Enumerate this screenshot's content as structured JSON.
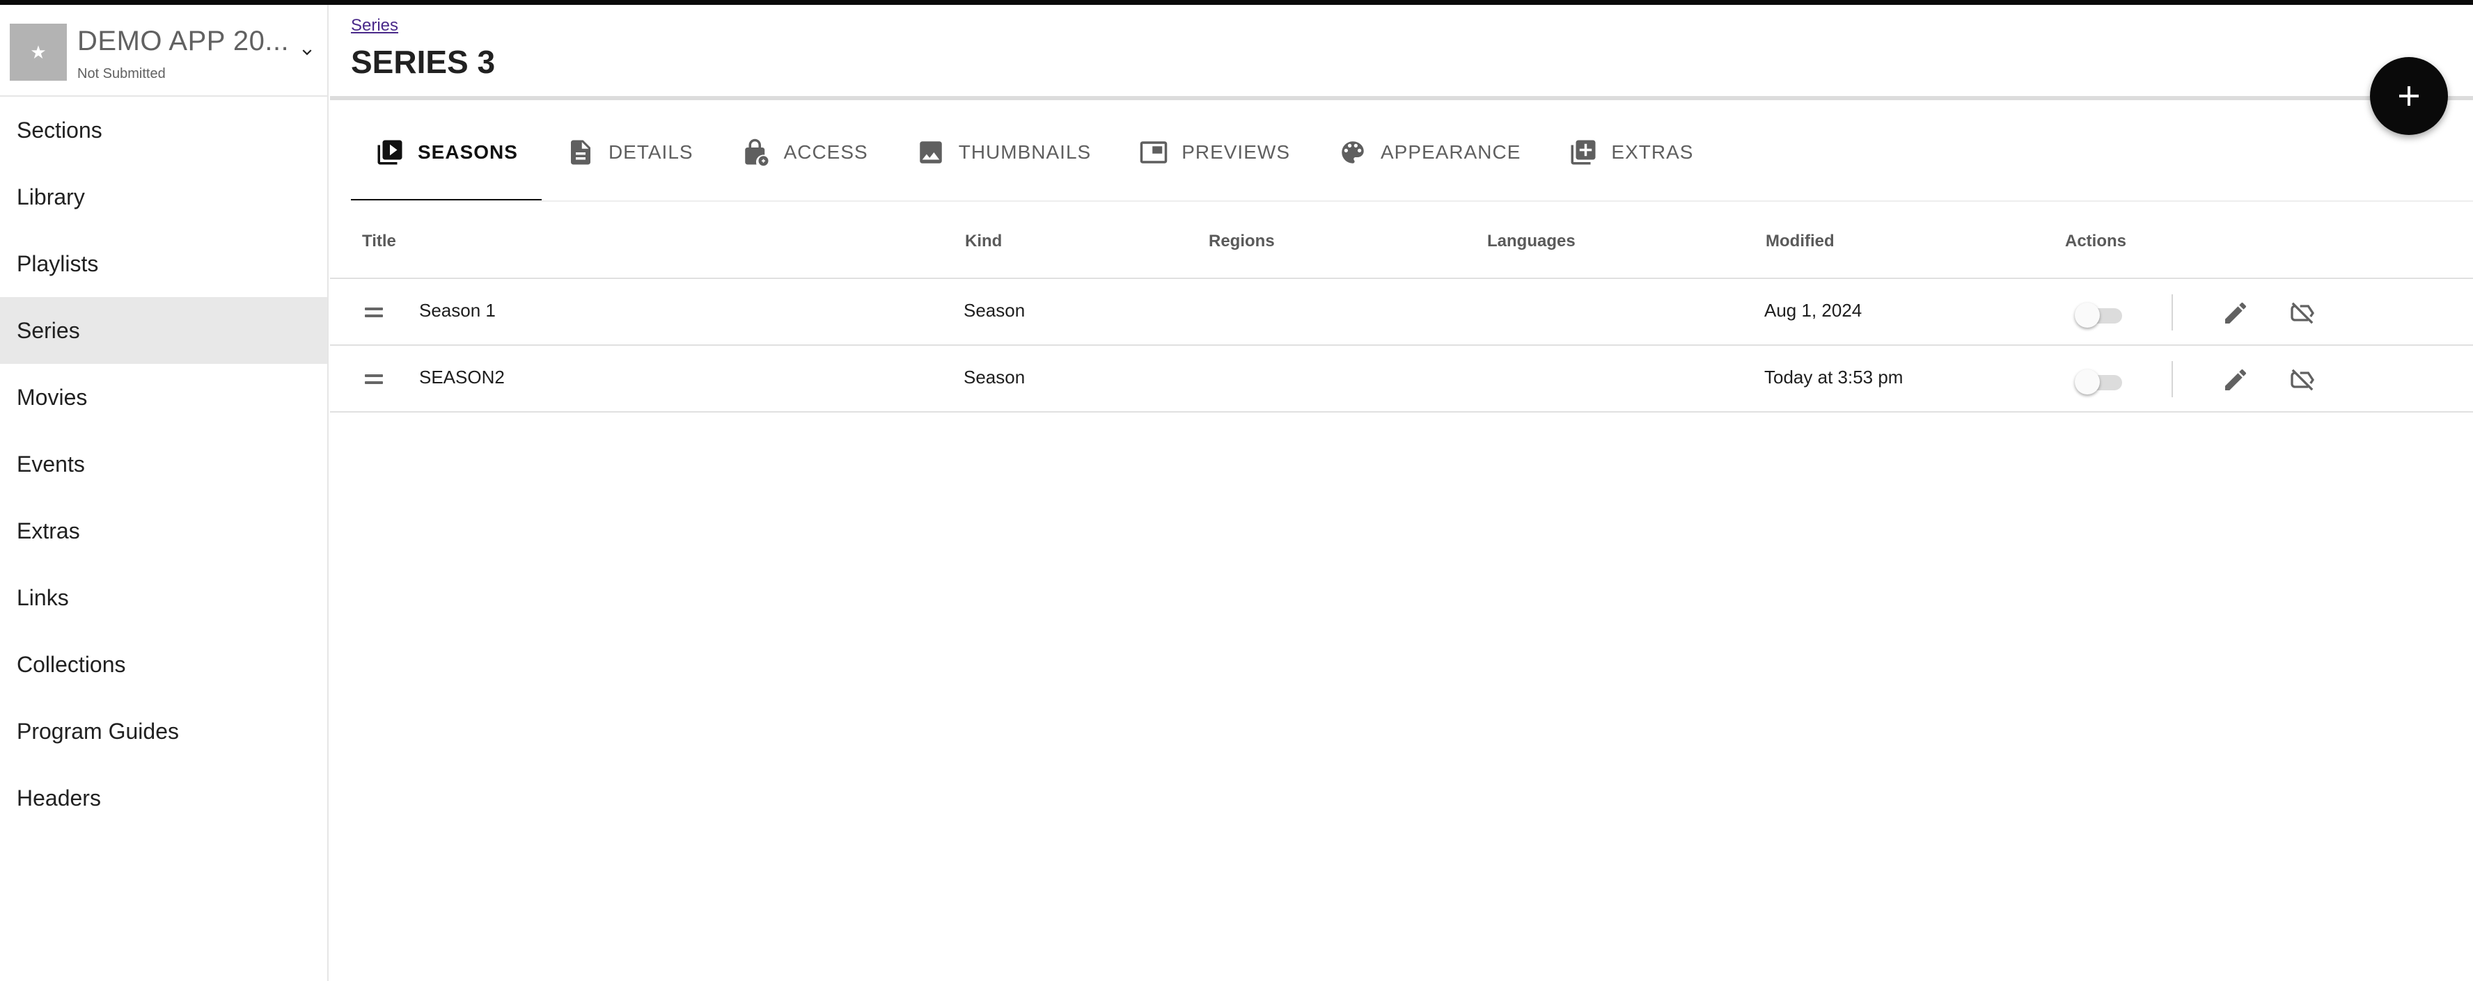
{
  "app": {
    "name": "DEMO APP 20...",
    "status": "Not Submitted",
    "logo_glyph": "★"
  },
  "sidebar": {
    "items": [
      {
        "label": "Sections"
      },
      {
        "label": "Library"
      },
      {
        "label": "Playlists"
      },
      {
        "label": "Series",
        "active": true
      },
      {
        "label": "Movies"
      },
      {
        "label": "Events"
      },
      {
        "label": "Extras"
      },
      {
        "label": "Links"
      },
      {
        "label": "Collections"
      },
      {
        "label": "Program Guides"
      },
      {
        "label": "Headers"
      }
    ]
  },
  "header": {
    "breadcrumb": "Series",
    "title": "SERIES 3"
  },
  "tabs": [
    {
      "label": "SEASONS",
      "icon": "video-library-icon",
      "active": true
    },
    {
      "label": "DETAILS",
      "icon": "document-icon"
    },
    {
      "label": "ACCESS",
      "icon": "lock-icon"
    },
    {
      "label": "THUMBNAILS",
      "icon": "image-icon"
    },
    {
      "label": "PREVIEWS",
      "icon": "preview-icon"
    },
    {
      "label": "APPEARANCE",
      "icon": "palette-icon"
    },
    {
      "label": "EXTRAS",
      "icon": "add-box-icon"
    }
  ],
  "table": {
    "columns": [
      "Title",
      "Kind",
      "Regions",
      "Languages",
      "Modified",
      "Actions"
    ],
    "rows": [
      {
        "title": "Season 1",
        "kind": "Season",
        "regions": "",
        "languages": "",
        "modified": "Aug 1, 2024",
        "enabled": false
      },
      {
        "title": "SEASON2",
        "kind": "Season",
        "regions": "",
        "languages": "",
        "modified": "Today at 3:53 pm",
        "enabled": false
      }
    ]
  },
  "colors": {
    "accent": "#0a0a0a",
    "active_nav_bg": "#e8e8e8",
    "link": "#4a2a8a"
  }
}
